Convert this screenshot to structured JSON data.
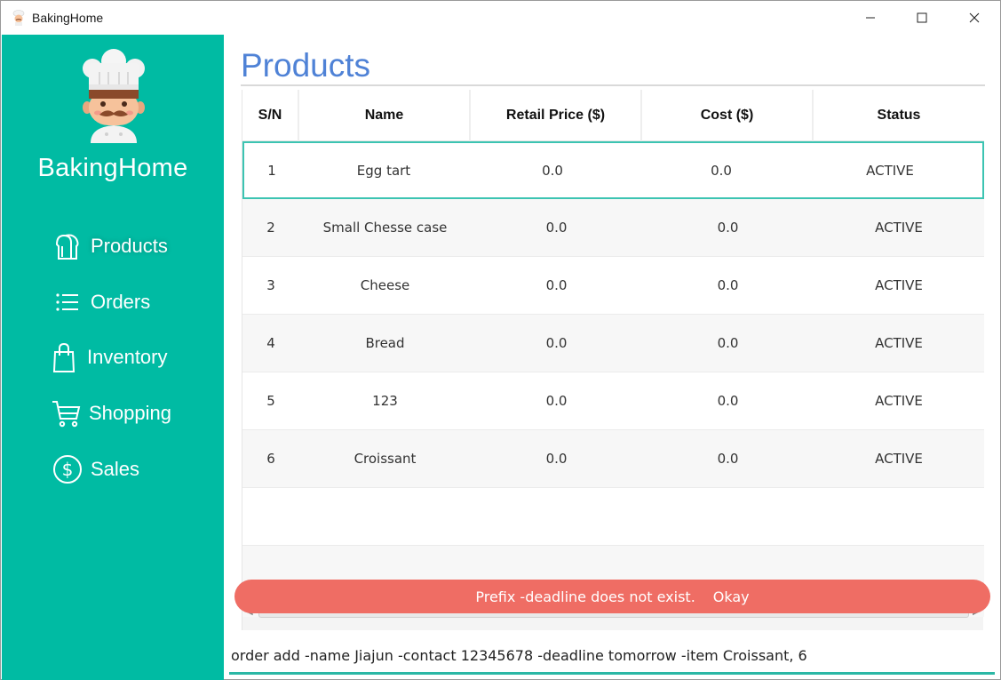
{
  "window": {
    "title": "BakingHome"
  },
  "sidebar": {
    "brand": "BakingHome",
    "items": [
      {
        "label": "Products",
        "icon": "bread-icon"
      },
      {
        "label": "Orders",
        "icon": "list-icon"
      },
      {
        "label": "Inventory",
        "icon": "bag-icon"
      },
      {
        "label": "Shopping",
        "icon": "cart-icon"
      },
      {
        "label": "Sales",
        "icon": "dollar-icon"
      }
    ]
  },
  "page": {
    "title": "Products"
  },
  "table": {
    "columns": [
      "S/N",
      "Name",
      "Retail Price ($)",
      "Cost ($)",
      "Status"
    ],
    "rows": [
      {
        "sn": "1",
        "name": "Egg tart",
        "price": "0.0",
        "cost": "0.0",
        "status": "ACTIVE"
      },
      {
        "sn": "2",
        "name": "Small Chesse case",
        "price": "0.0",
        "cost": "0.0",
        "status": "ACTIVE"
      },
      {
        "sn": "3",
        "name": "Cheese",
        "price": "0.0",
        "cost": "0.0",
        "status": "ACTIVE"
      },
      {
        "sn": "4",
        "name": "Bread",
        "price": "0.0",
        "cost": "0.0",
        "status": "ACTIVE"
      },
      {
        "sn": "5",
        "name": "123",
        "price": "0.0",
        "cost": "0.0",
        "status": "ACTIVE"
      },
      {
        "sn": "6",
        "name": "Croissant",
        "price": "0.0",
        "cost": "0.0",
        "status": "ACTIVE"
      }
    ]
  },
  "toast": {
    "message": "Prefix -deadline does not exist.",
    "action": "Okay"
  },
  "command": {
    "value": "order add -name Jiajun -contact 12345678 -deadline tomorrow -item Croissant, 6"
  },
  "colors": {
    "sidebar": "#00bba3",
    "title": "#4f82d6",
    "toast": "#ef6d64",
    "accent": "#2bb7a5"
  }
}
